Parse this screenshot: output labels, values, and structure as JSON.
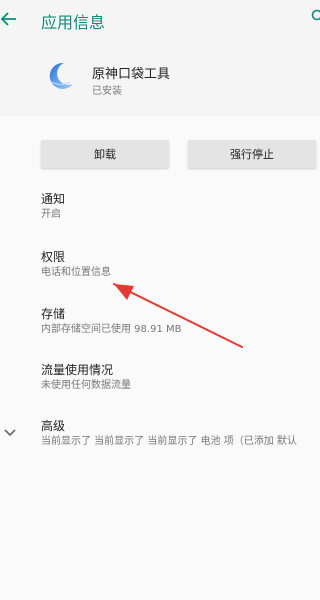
{
  "header": {
    "title": "应用信息",
    "back_icon": "arrow-left-icon",
    "search_icon": "search-icon"
  },
  "app": {
    "name": "原神口袋工具",
    "status": "已安装",
    "icon": "crescent-moon-app-icon"
  },
  "buttons": {
    "uninstall": "卸载",
    "force_stop": "强行停止"
  },
  "settings": [
    {
      "title": "通知",
      "subtitle": "开启"
    },
    {
      "title": "权限",
      "subtitle": "电话和位置信息"
    },
    {
      "title": "存储",
      "subtitle": "内部存储空间已使用 98.91 MB"
    },
    {
      "title": "流量使用情况",
      "subtitle": "未使用任何数据流量"
    },
    {
      "title": "高级",
      "subtitle": "当前显示了 当前显示了 当前显示了 电池 项（已添加 默认"
    }
  ],
  "annotation": {
    "color": "#e53935"
  },
  "colors": {
    "accent": "#0f8a7c",
    "background": "#fafafa"
  }
}
